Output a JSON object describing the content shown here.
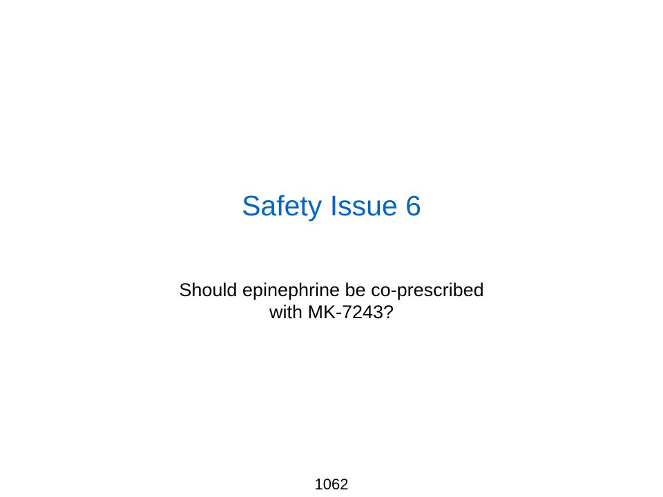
{
  "slide": {
    "title": "Safety Issue 6",
    "subtitle_lines": [
      "Should epinephrine be co-prescribed",
      "with MK-7243?"
    ],
    "page_number": "1062"
  },
  "colors": {
    "title": "#0066cc",
    "text": "#000000",
    "background": "#ffffff"
  }
}
